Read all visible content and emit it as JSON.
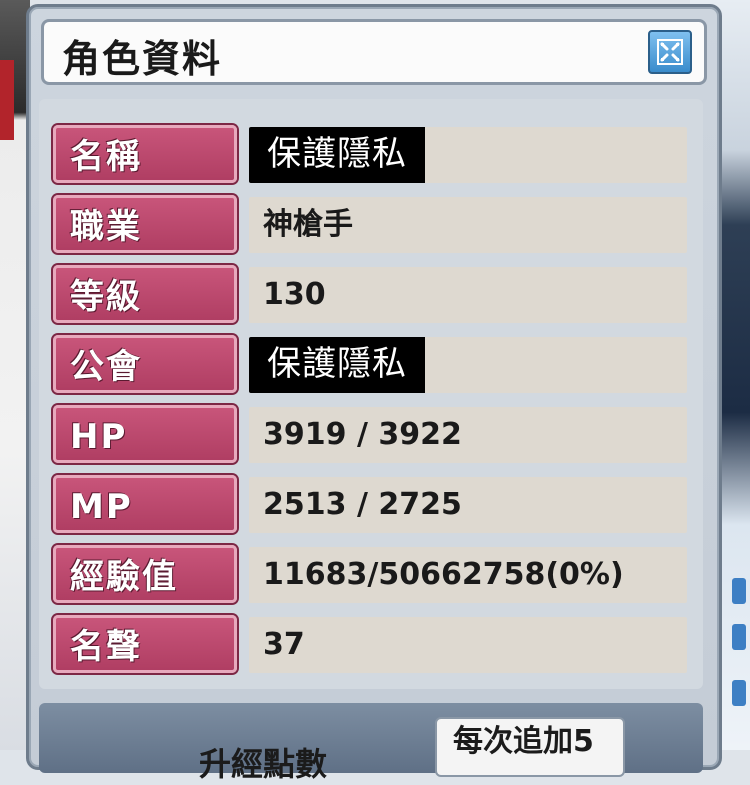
{
  "window": {
    "title": "角色資料",
    "close_icon": "close-icon"
  },
  "rows": [
    {
      "label": "名稱",
      "value": "保護隱私",
      "redacted": true
    },
    {
      "label": "職業",
      "value": "神槍手"
    },
    {
      "label": "等級",
      "value": "130"
    },
    {
      "label": "公會",
      "value": "保護隱私",
      "redacted": true
    },
    {
      "label": "HP",
      "value": "3919 / 3922"
    },
    {
      "label": "MP",
      "value": "2513 / 2725"
    },
    {
      "label": "經驗值",
      "value": "11683/50662758(0%)"
    },
    {
      "label": "名聲",
      "value": "37"
    }
  ],
  "footer": {
    "label": "升經點數",
    "box_text": "每次追加5"
  },
  "colors": {
    "label_bg": "#b84569",
    "value_bg": "#ded9d0",
    "accent_blue": "#3a8ccc"
  }
}
